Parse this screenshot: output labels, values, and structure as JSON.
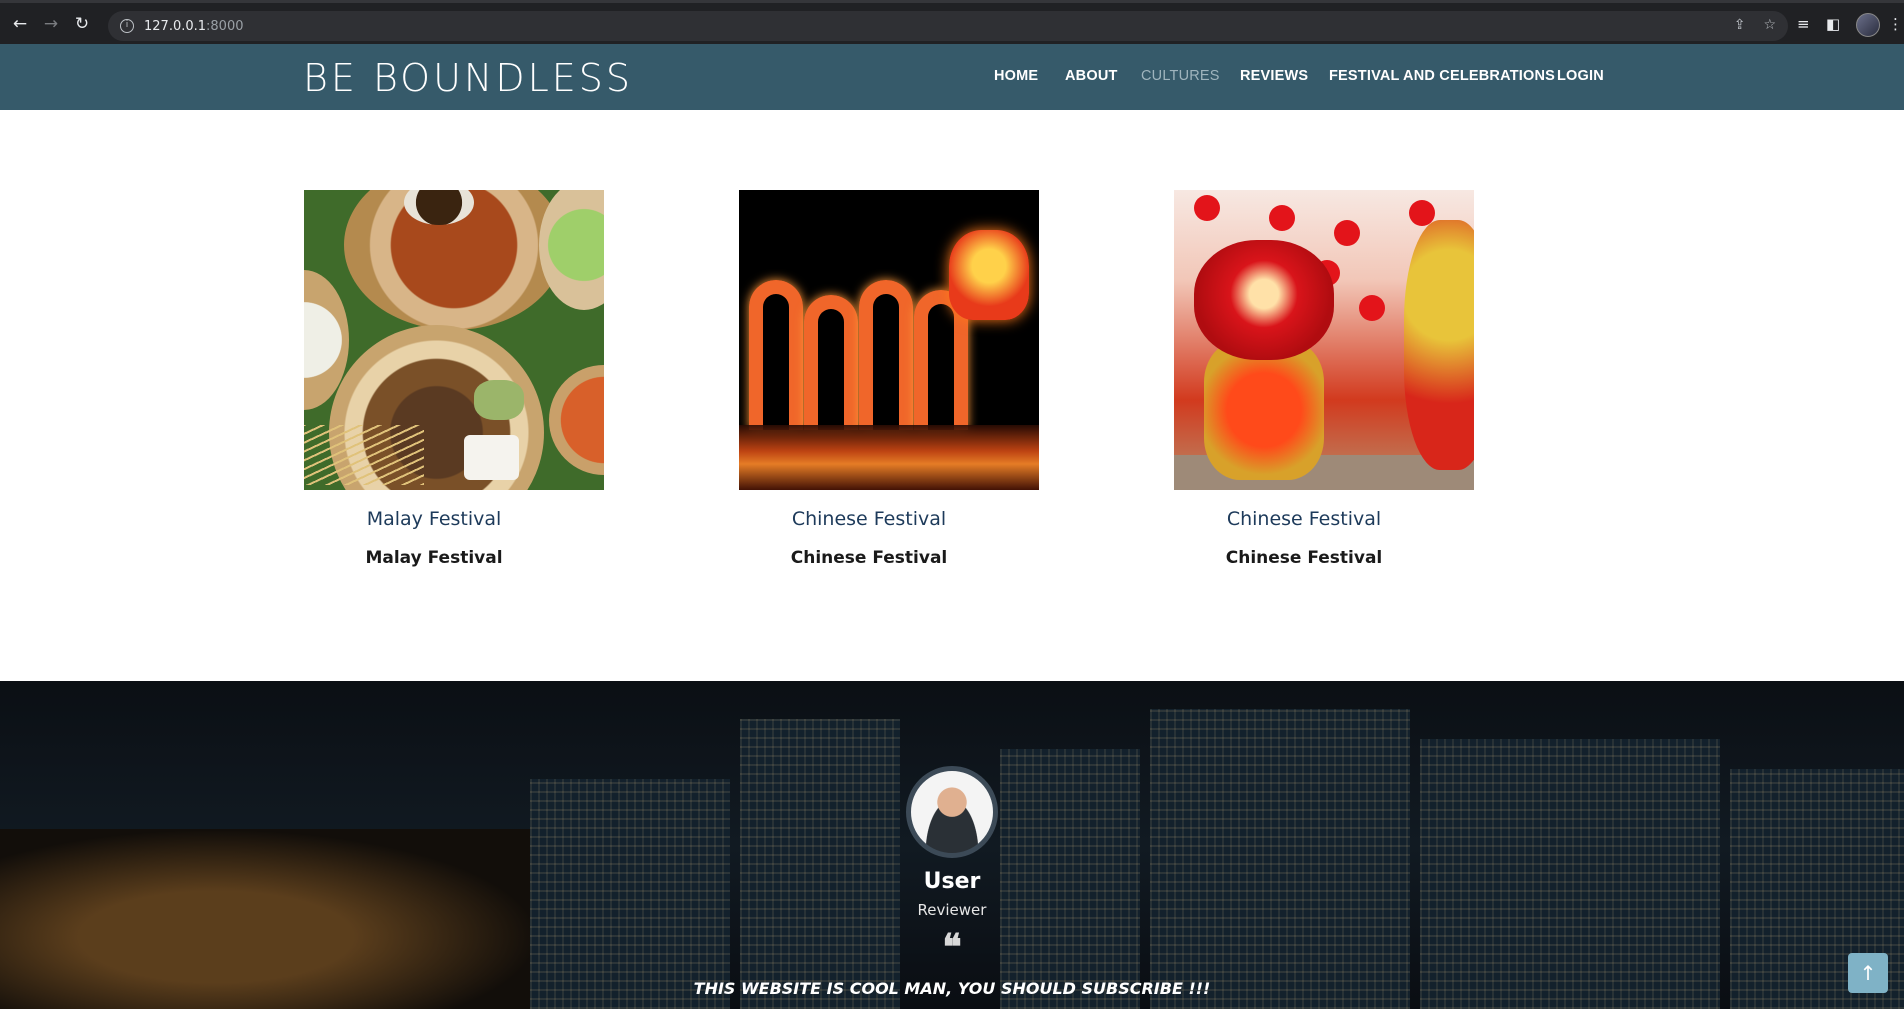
{
  "browser": {
    "url_host": "127.0.0.1",
    "url_port": ":8000"
  },
  "header": {
    "brand": "BE BOUNDLESS",
    "nav": [
      {
        "label": "HOME"
      },
      {
        "label": "ABOUT"
      },
      {
        "label": "CULTURES",
        "active": true
      },
      {
        "label": "REVIEWS"
      },
      {
        "label": "FESTIVAL AND CELEBRATIONS"
      },
      {
        "label": "LOGIN"
      }
    ]
  },
  "cards": [
    {
      "title": "Malay Festival",
      "subtitle": "Malay Festival",
      "image": "malay-food-photo"
    },
    {
      "title": "Chinese Festival",
      "subtitle": "Chinese Festival",
      "image": "dragon-lantern-photo"
    },
    {
      "title": "Chinese Festival",
      "subtitle": "Chinese Festival",
      "image": "lion-dance-photo"
    }
  ],
  "review": {
    "name": "User",
    "role": "Reviewer",
    "quote_icon": "❝",
    "text": "THIS WEBSITE IS COOL MAN, YOU SHOULD SUBSCRIBE !!!"
  },
  "colors": {
    "header_bg": "#365a6a",
    "nav_active": "#9fb4bd",
    "card_title": "#1d3a5a",
    "to_top_bg": "#7fb2c6"
  },
  "icons": {
    "back": "arrow-left-icon",
    "forward": "arrow-right-icon",
    "reload": "reload-icon",
    "to_top": "arrow-up-icon"
  }
}
